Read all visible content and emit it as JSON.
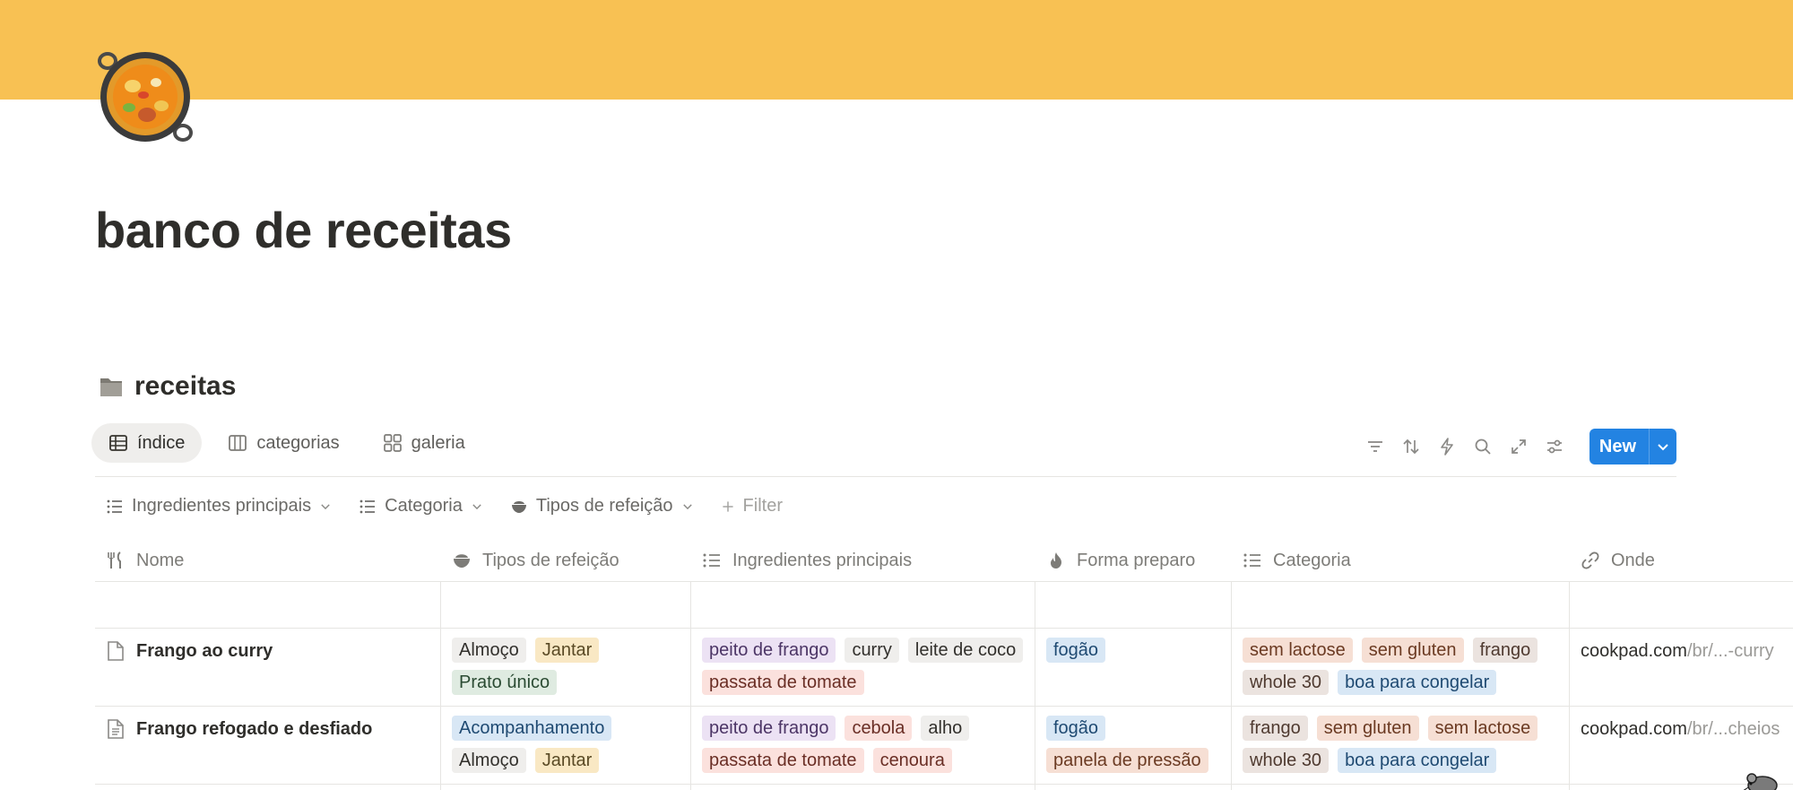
{
  "page": {
    "title": "banco de receitas",
    "icon": "paella-pan-icon",
    "cover_color": "#f8c153"
  },
  "database": {
    "icon": "folder-icon",
    "title": "receitas"
  },
  "views": [
    {
      "label": "índice",
      "icon": "table-icon",
      "active": true
    },
    {
      "label": "categorias",
      "icon": "board-icon",
      "active": false
    },
    {
      "label": "galeria",
      "icon": "gallery-icon",
      "active": false
    }
  ],
  "toolbar": {
    "icons": [
      "filter-icon",
      "sort-icon",
      "automation-icon",
      "search-icon",
      "expand-icon",
      "settings-icon"
    ],
    "new_label": "New",
    "accent": "#2383e2"
  },
  "filters": [
    {
      "label": "Ingredientes principais",
      "icon": "list-icon"
    },
    {
      "label": "Categoria",
      "icon": "list-icon"
    },
    {
      "label": "Tipos de refeição",
      "icon": "bowl-icon"
    }
  ],
  "filter_add_label": "Filter",
  "columns": [
    {
      "label": "Nome",
      "icon": "utensils-icon"
    },
    {
      "label": "Tipos de refeição",
      "icon": "bowl-icon"
    },
    {
      "label": "Ingredientes principais",
      "icon": "list-icon"
    },
    {
      "label": "Forma preparo",
      "icon": "fire-icon"
    },
    {
      "label": "Categoria",
      "icon": "list-icon"
    },
    {
      "label": "Onde",
      "icon": "link-icon"
    }
  ],
  "rows": [
    {
      "name": "Frango ao curry",
      "tipos": [
        {
          "label": "Almoço",
          "color": "gray"
        },
        {
          "label": "Jantar",
          "color": "yellow"
        },
        {
          "label": "Prato único",
          "color": "green"
        }
      ],
      "ingredientes": [
        {
          "label": "peito de frango",
          "color": "purple"
        },
        {
          "label": "curry",
          "color": "gray"
        },
        {
          "label": "leite de coco",
          "color": "gray"
        },
        {
          "label": "passata de tomate",
          "color": "red"
        }
      ],
      "forma": [
        {
          "label": "fogão",
          "color": "blue"
        }
      ],
      "categoria": [
        {
          "label": "sem lactose",
          "color": "orange"
        },
        {
          "label": "sem gluten",
          "color": "orange"
        },
        {
          "label": "frango",
          "color": "brown"
        },
        {
          "label": "whole 30",
          "color": "brown"
        },
        {
          "label": "boa para congelar",
          "color": "blue"
        }
      ],
      "onde": {
        "host": "cookpad.com",
        "path": "/br/...-curry"
      }
    },
    {
      "name": "Frango refogado e desfiado",
      "tipos": [
        {
          "label": "Acompanhamento",
          "color": "blue"
        },
        {
          "label": "Almoço",
          "color": "gray"
        },
        {
          "label": "Jantar",
          "color": "yellow"
        }
      ],
      "ingredientes": [
        {
          "label": "peito de frango",
          "color": "purple"
        },
        {
          "label": "cebola",
          "color": "red"
        },
        {
          "label": "alho",
          "color": "gray"
        },
        {
          "label": "passata de tomate",
          "color": "red"
        },
        {
          "label": "cenoura",
          "color": "red"
        }
      ],
      "forma": [
        {
          "label": "fogão",
          "color": "blue"
        },
        {
          "label": "panela de pressão",
          "color": "orange"
        }
      ],
      "categoria": [
        {
          "label": "frango",
          "color": "brown"
        },
        {
          "label": "sem gluten",
          "color": "orange"
        },
        {
          "label": "sem lactose",
          "color": "orange"
        },
        {
          "label": "whole 30",
          "color": "brown"
        },
        {
          "label": "boa para congelar",
          "color": "blue"
        }
      ],
      "onde": {
        "host": "cookpad.com",
        "path": "/br/...cheios"
      }
    }
  ]
}
